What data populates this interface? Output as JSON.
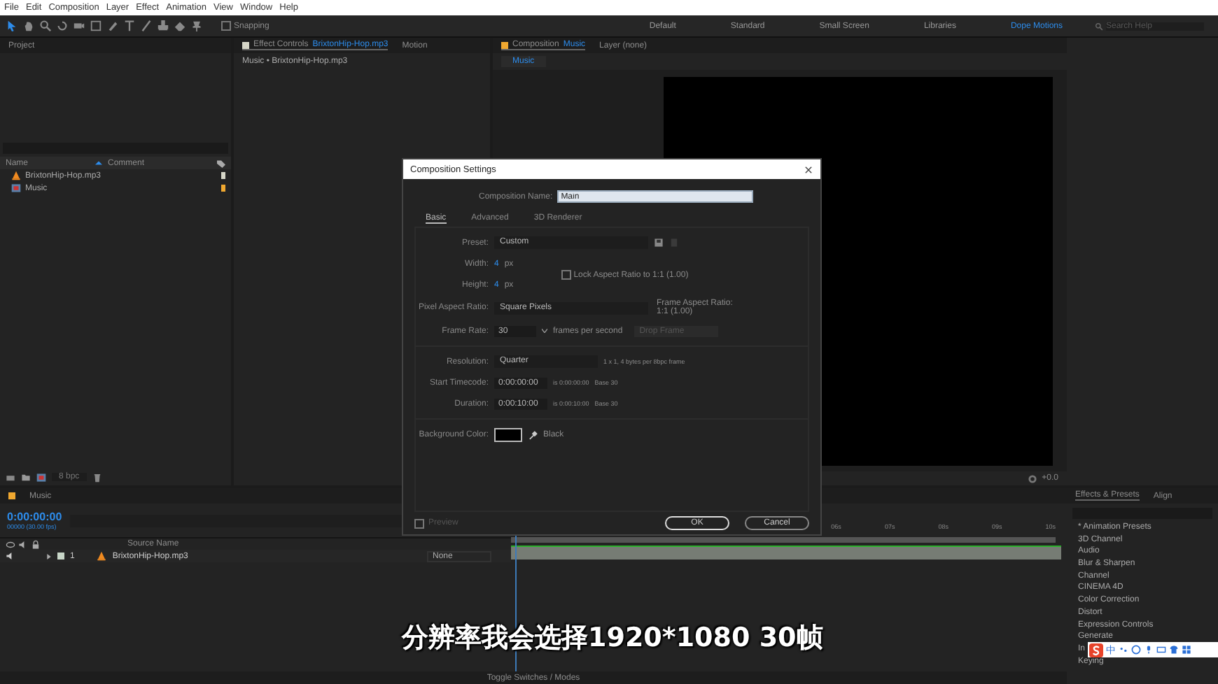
{
  "menu_bar": [
    "File",
    "Edit",
    "Composition",
    "Layer",
    "Effect",
    "Animation",
    "View",
    "Window",
    "Help"
  ],
  "toolbar": {
    "snapping": {
      "label": "Snapping",
      "checked": false
    }
  },
  "workspaces": [
    {
      "label": "Default",
      "selected": false
    },
    {
      "label": "Standard",
      "selected": false
    },
    {
      "label": "Small Screen",
      "selected": false
    },
    {
      "label": "Libraries",
      "selected": false
    },
    {
      "label": "Dope Motions",
      "selected": true
    }
  ],
  "search_help": {
    "placeholder": "Search Help"
  },
  "project_panel": {
    "tab": "Project",
    "columns": [
      "Name",
      "Comment"
    ],
    "items": [
      {
        "name": "BrixtonHip-Hop.mp3",
        "kind": "audio",
        "color": "#d6d6c8"
      },
      {
        "name": "Music",
        "kind": "composition",
        "color": "#f0a830"
      }
    ],
    "bpc": "8 bpc"
  },
  "effect_controls": {
    "tabs": [
      {
        "label": "Effect Controls",
        "target": "BrixtonHip-Hop.mp3",
        "selected": true
      },
      {
        "label": "Motion",
        "selected": false
      }
    ],
    "header": "Music • BrixtonHip-Hop.mp3"
  },
  "composition_panel": {
    "tabs": [
      {
        "label": "Composition",
        "target": "Music",
        "selected": true
      },
      {
        "label": "Layer (none)",
        "selected": false
      }
    ],
    "breadcrumb": "Music",
    "zoom": "+0.0"
  },
  "dialog": {
    "title": "Composition Settings",
    "name_label": "Composition Name:",
    "name_value": "Main",
    "tabs": [
      {
        "label": "Basic",
        "selected": true
      },
      {
        "label": "Advanced",
        "selected": false
      },
      {
        "label": "3D Renderer",
        "selected": false
      }
    ],
    "preset": {
      "label": "Preset:",
      "value": "Custom"
    },
    "width": {
      "label": "Width:",
      "value": "4",
      "unit": "px"
    },
    "height": {
      "label": "Height:",
      "value": "4",
      "unit": "px"
    },
    "lock_aspect": {
      "label": "Lock Aspect Ratio to 1:1 (1.00)",
      "checked": false
    },
    "pixel_aspect": {
      "label": "Pixel Aspect Ratio:",
      "value": "Square Pixels"
    },
    "frame_aspect": {
      "label": "Frame Aspect Ratio:",
      "value": "1:1 (1.00)"
    },
    "frame_rate": {
      "label": "Frame Rate:",
      "value": "30",
      "unit": "frames per second",
      "drop_frame": "Drop Frame"
    },
    "resolution": {
      "label": "Resolution:",
      "value": "Quarter",
      "info": "1 x 1, 4 bytes per 8bpc frame"
    },
    "start_timecode": {
      "label": "Start Timecode:",
      "value": "0:00:00:00",
      "info": "is 0:00:00:00",
      "base": "Base 30"
    },
    "duration": {
      "label": "Duration:",
      "value": "0:00:10:00",
      "info": "is 0:00:10:00",
      "base": "Base 30"
    },
    "background": {
      "label": "Background Color:",
      "color": "#000000",
      "name": "Black"
    },
    "preview": {
      "label": "Preview",
      "checked": false
    },
    "buttons": [
      "OK",
      "Cancel"
    ]
  },
  "timeline": {
    "tab": "Music",
    "timecode": "0:00:00:00",
    "frame_info": "00000 (30.00 fps)",
    "columns": [
      "Source Name"
    ],
    "layers": [
      {
        "number": "1",
        "name": "BrixtonHip-Hop.mp3",
        "parent": "None"
      }
    ],
    "ruler": [
      "06s",
      "07s",
      "08s",
      "09s",
      "10s"
    ],
    "footer": "Toggle Switches / Modes"
  },
  "effects_panel": {
    "tabs": [
      {
        "label": "Effects & Presets",
        "selected": true
      },
      {
        "label": "Align",
        "selected": false
      }
    ],
    "items": [
      "* Animation Presets",
      "3D Channel",
      "Audio",
      "Blur & Sharpen",
      "Channel",
      "CINEMA 4D",
      "Color Correction",
      "Distort",
      "Expression Controls",
      "Generate",
      "In",
      "Keying"
    ]
  },
  "subtitle": "分辨率我会选择1920*1080 30帧",
  "ime_bar": {
    "label": "中"
  }
}
